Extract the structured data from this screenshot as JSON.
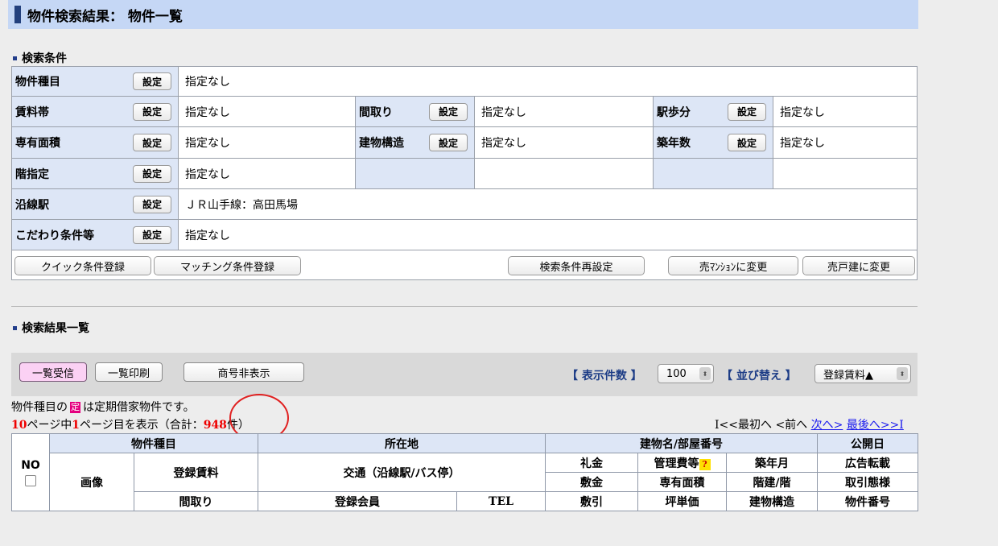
{
  "header": {
    "title": "物件検索結果： 物件一覧"
  },
  "conditions": {
    "section_title": "検索条件",
    "set_label": "設定",
    "rows": [
      [
        {
          "label": "物件種目",
          "value": "指定なし"
        }
      ],
      [
        {
          "label": "賃料帯",
          "value": "指定なし"
        },
        {
          "label": "間取り",
          "value": "指定なし"
        },
        {
          "label": "駅歩分",
          "value": "指定なし"
        }
      ],
      [
        {
          "label": "専有面積",
          "value": "指定なし"
        },
        {
          "label": "建物構造",
          "value": "指定なし"
        },
        {
          "label": "築年数",
          "value": "指定なし"
        }
      ],
      [
        {
          "label": "階指定",
          "value": "指定なし"
        }
      ],
      [
        {
          "label": "沿線駅",
          "value": "ＪＲ山手線：高田馬場"
        }
      ],
      [
        {
          "label": "こだわり条件等",
          "value": "指定なし"
        }
      ]
    ],
    "buttons": {
      "quick_register": "クイック条件登録",
      "matching_register": "マッチング条件登録",
      "reset": "検索条件再設定",
      "to_mansion": "売ﾏﾝｼｮﾝに変更",
      "to_house": "売戸建に変更"
    }
  },
  "results": {
    "section_title": "検索結果一覧",
    "toolbar": {
      "receive_list": "一覧受信",
      "print_list": "一覧印刷",
      "hide_trade_name": "商号非表示",
      "count_label": "【 表示件数 】",
      "count_value": "100",
      "sort_label": "【 並び替え 】",
      "sort_value": "登録賃料▲"
    },
    "note_prefix": "物件種目の",
    "note_badge": "定",
    "note_suffix": "は定期借家物件です。",
    "summary": {
      "total_pages": "10",
      "pages_text": "ページ中",
      "current_page": "1",
      "current_text": "ページ目を表示（合計：",
      "total_count": "948",
      "count_suffix": "件）"
    },
    "pager": {
      "first": "I<<最初へ",
      "prev": "<前へ",
      "next": "次へ>",
      "last": "最後へ>>I"
    },
    "table": {
      "no": "NO",
      "type": "物件種目",
      "location": "所在地",
      "building": "建物名/部屋番号",
      "published": "公開日",
      "image": "画像",
      "rent": "登録賃料",
      "transport": "交通（沿線駅/バス停）",
      "key_money": "礼金",
      "mgmt_fee": "管理費等",
      "qmark": "?",
      "built": "築年月",
      "ad_reprint": "広告転載",
      "deposit": "敷金",
      "area": "専有面積",
      "floor": "階建/階",
      "trade_mode": "取引態様",
      "layout": "間取り",
      "member": "登録会員",
      "tel": "TEL",
      "deduction": "敷引",
      "tsubo_price": "坪単価",
      "structure": "建物構造",
      "property_no": "物件番号"
    }
  }
}
